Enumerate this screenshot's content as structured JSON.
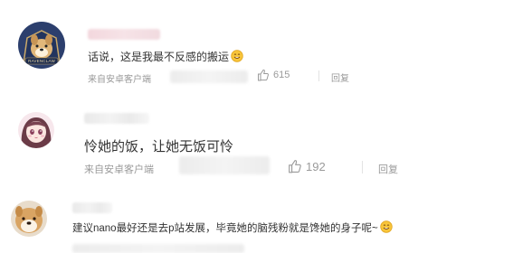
{
  "comments": [
    {
      "text": "话说，这是我最不反感的搬运",
      "source": "来自安卓客户端",
      "likes": "615",
      "reply": "回复",
      "avatar_badge": "RAVENCLAW",
      "has_emoji": true
    },
    {
      "text": "怜她的饭，让她无饭可怜",
      "source": "来自安卓客户端",
      "likes": "192",
      "reply": "回复",
      "has_emoji": false
    },
    {
      "text": "建议nano最好还是去p站发展，毕竟她的脑残粉就是馋她的身子呢~",
      "has_emoji": true
    }
  ],
  "icons": {
    "like": "thumbs-up-icon",
    "emoji": "smile-emoji-icon"
  },
  "colors": {
    "text": "#333333",
    "meta": "#9a9a9a",
    "blur": "#ececec"
  }
}
